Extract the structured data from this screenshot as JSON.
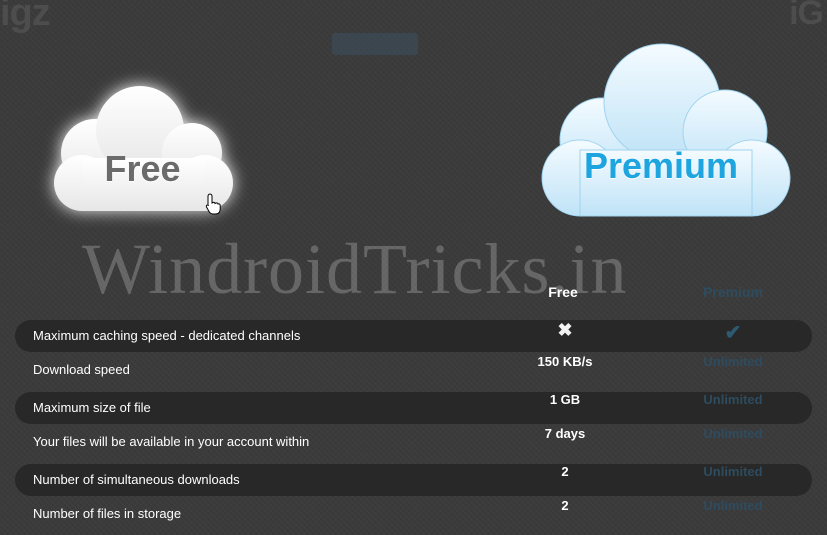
{
  "header": {
    "logo_left": "igz",
    "logo_right": "iG"
  },
  "plans": {
    "free_label": "Free",
    "premium_label": "Premium"
  },
  "watermark": "WindroidTricks.in",
  "columns": {
    "free": "Free",
    "premium": "Premium"
  },
  "rows": [
    {
      "feature": "Maximum caching speed - dedicated channels",
      "free": "✖",
      "premium": "✔"
    },
    {
      "feature": "Download speed",
      "free": "150 KB/s",
      "premium": "Unlimited"
    },
    {
      "feature": "Maximum size of file",
      "free": "1 GB",
      "premium": "Unlimited"
    },
    {
      "feature": "Your files will be available in your account within",
      "free": "7 days",
      "premium": "Unlimited"
    },
    {
      "feature": "Number of simultaneous downloads",
      "free": "2",
      "premium": "Unlimited"
    },
    {
      "feature": "Number of files in storage",
      "free": "2",
      "premium": "Unlimited"
    }
  ],
  "colors": {
    "background": "#3b3b3b",
    "stripe": "#282828",
    "premium_blue": "#1ea5e0",
    "premium_text": "#2d4c5f"
  }
}
